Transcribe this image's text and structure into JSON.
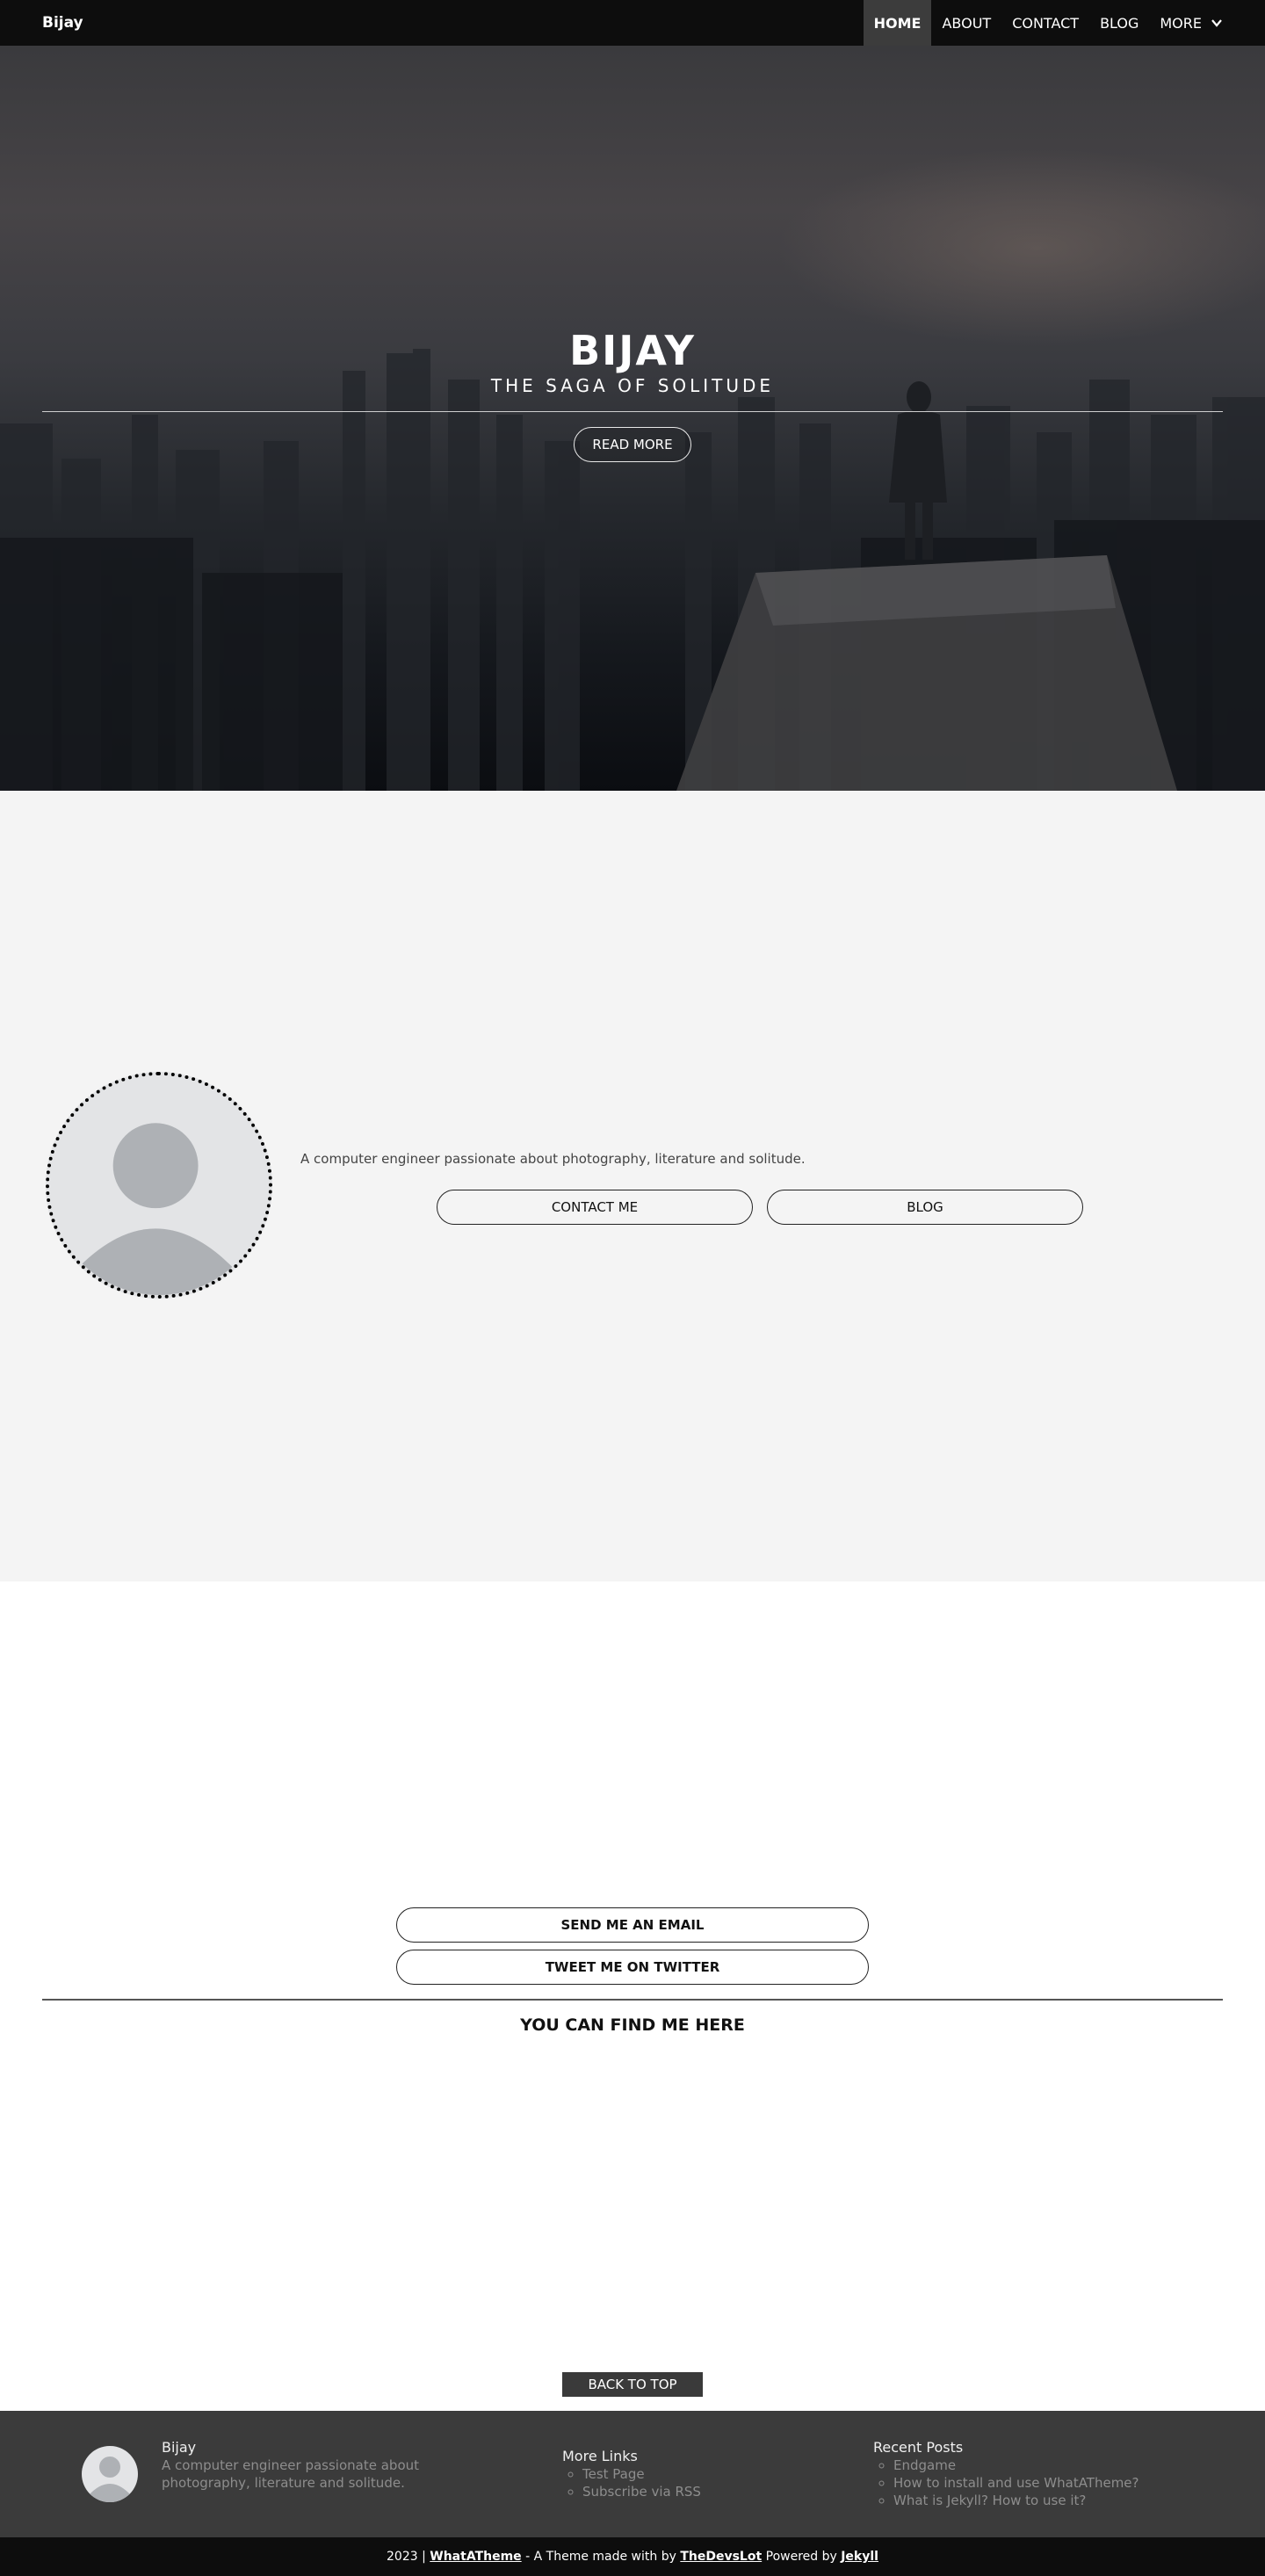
{
  "navbar": {
    "brand": "Bijay",
    "items": [
      {
        "label": "HOME",
        "active": true
      },
      {
        "label": "ABOUT",
        "active": false
      },
      {
        "label": "CONTACT",
        "active": false
      },
      {
        "label": "BLOG",
        "active": false
      },
      {
        "label": "MORE",
        "active": false
      }
    ],
    "more_icon": "chevron-down-icon"
  },
  "hero": {
    "title": "BIJAY",
    "subtitle": "THE SAGA OF SOLITUDE",
    "read_more": "READ MORE"
  },
  "about": {
    "avatar_icon": "user-avatar-icon",
    "description": "A computer engineer passionate about photography, literature and solitude.",
    "contact_button": "CONTACT ME",
    "blog_button": "BLOG"
  },
  "contact": {
    "email_button": "SEND ME AN EMAIL",
    "twitter_button": "TWEET ME ON TWITTER",
    "find_me_heading": "YOU CAN FIND ME HERE",
    "back_to_top": "BACK TO TOP"
  },
  "footer": {
    "name": "Bijay",
    "bio": "A computer engineer passionate about photography, literature and solitude.",
    "more_links_heading": "More Links",
    "more_links": [
      "Test Page",
      "Subscribe via RSS"
    ],
    "recent_posts_heading": "Recent Posts",
    "recent_posts": [
      "Endgame",
      "How to install and use WhatATheme?",
      "What is Jekyll? How to use it?"
    ]
  },
  "bottom_bar": {
    "prefix": "2023 | ",
    "theme_link": "WhatATheme",
    "middle": " - A Theme made with by ",
    "author_link": "TheDevsLot",
    "powered": " Powered by ",
    "jekyll_link": "Jekyll"
  },
  "colors": {
    "navbar_bg": "#0d0d0d",
    "nav_active_bg": "#3c3c3c",
    "about_bg": "#f4f4f4",
    "footer_bg": "#3b3b3b",
    "muted_text": "#8d8d8d"
  }
}
